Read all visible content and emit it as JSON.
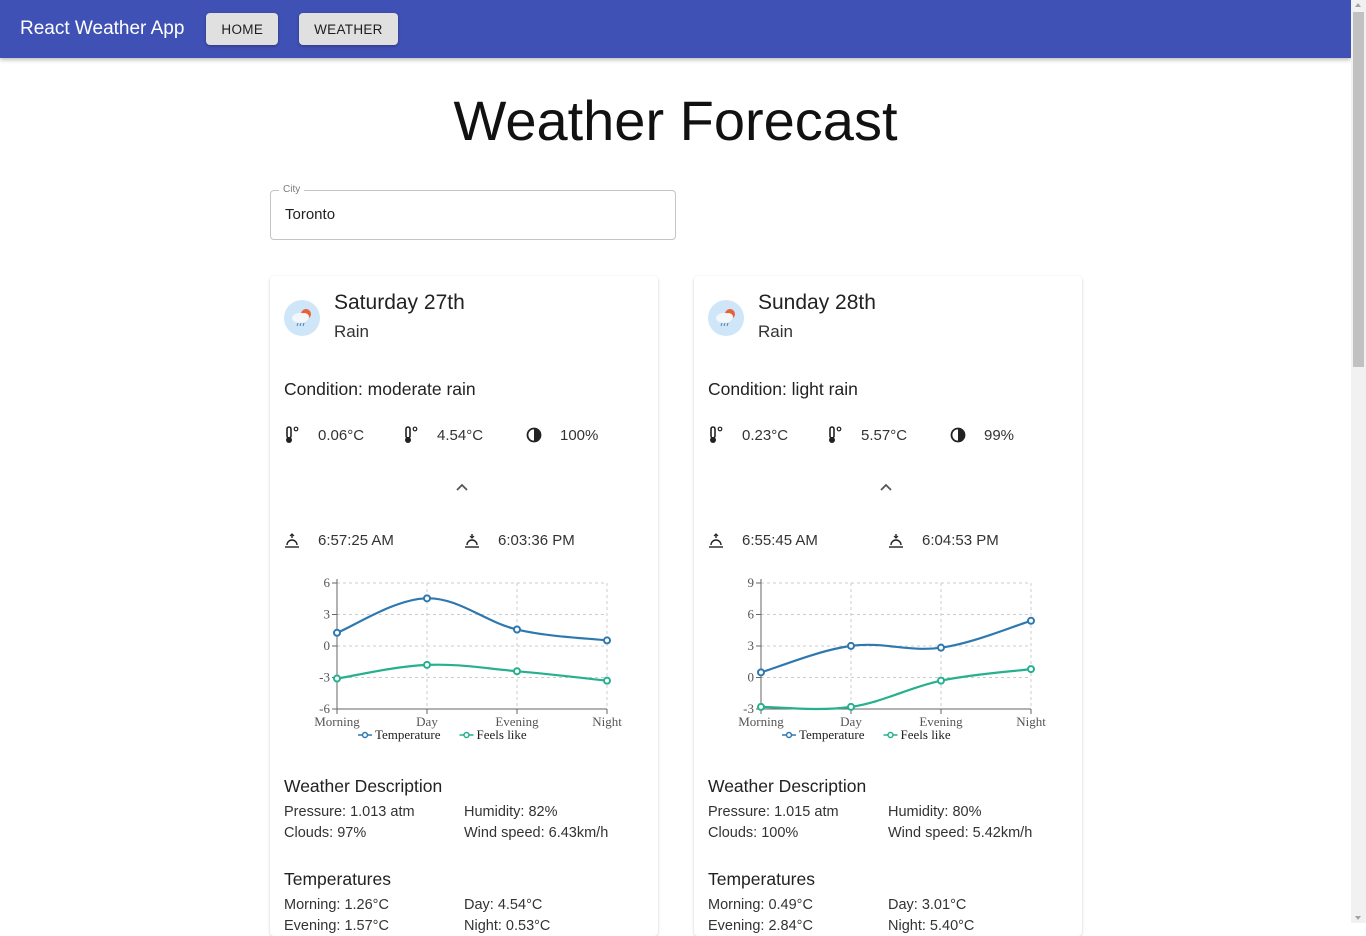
{
  "appbar": {
    "title": "React Weather App",
    "nav": [
      {
        "label": "HOME"
      },
      {
        "label": "WEATHER"
      }
    ],
    "color": "#3f51b5"
  },
  "page": {
    "title": "Weather Forecast"
  },
  "city": {
    "label": "City",
    "value": "Toronto"
  },
  "cards": [
    {
      "day": "Saturday 27th",
      "main": "Rain",
      "icon": "rain-cloud-icon",
      "condition": "Condition: moderate rain",
      "temp_min": "0.06°C",
      "temp_max": "4.54°C",
      "humidity_pct": "100%",
      "sunrise": "6:57:25 AM",
      "sunset": "6:03:36 PM",
      "desc_title": "Weather Description",
      "pressure": "Pressure: 1.013 atm",
      "humidity": "Humidity: 82%",
      "clouds": "Clouds: 97%",
      "wind": "Wind speed: 6.43km/h",
      "temps_title": "Temperatures",
      "morning": "Morning: 1.26°C",
      "day_temp": "Day: 4.54°C",
      "evening": "Evening: 1.57°C",
      "night": "Night: 0.53°C"
    },
    {
      "day": "Sunday 28th",
      "main": "Rain",
      "icon": "rain-cloud-icon",
      "condition": "Condition: light rain",
      "temp_min": "0.23°C",
      "temp_max": "5.57°C",
      "humidity_pct": "99%",
      "sunrise": "6:55:45 AM",
      "sunset": "6:04:53 PM",
      "desc_title": "Weather Description",
      "pressure": "Pressure: 1.015 atm",
      "humidity": "Humidity: 80%",
      "clouds": "Clouds: 100%",
      "wind": "Wind speed: 5.42km/h",
      "temps_title": "Temperatures",
      "morning": "Morning: 0.49°C",
      "day_temp": "Day: 3.01°C",
      "evening": "Evening: 2.84°C",
      "night": "Night: 5.40°C"
    }
  ],
  "chart_data": [
    {
      "type": "line",
      "title": "",
      "categories": [
        "Morning",
        "Day",
        "Evening",
        "Night"
      ],
      "yticks": [
        -6,
        -3,
        0,
        3,
        6
      ],
      "ylim": [
        -6,
        6
      ],
      "grid": true,
      "legend": "bottom",
      "series": [
        {
          "name": "Temperature",
          "color": "#2e78b0",
          "values": [
            1.26,
            4.54,
            1.57,
            0.53
          ]
        },
        {
          "name": "Feels like",
          "color": "#26b08f",
          "values": [
            -3.1,
            -1.8,
            -2.4,
            -3.3
          ]
        }
      ]
    },
    {
      "type": "line",
      "title": "",
      "categories": [
        "Morning",
        "Day",
        "Evening",
        "Night"
      ],
      "yticks": [
        -3,
        0,
        3,
        6,
        9
      ],
      "ylim": [
        -3,
        9
      ],
      "grid": true,
      "legend": "bottom",
      "series": [
        {
          "name": "Temperature",
          "color": "#2e78b0",
          "values": [
            0.49,
            3.01,
            2.84,
            5.4
          ]
        },
        {
          "name": "Feels like",
          "color": "#26b08f",
          "values": [
            -2.8,
            -2.8,
            -0.3,
            0.8
          ]
        }
      ]
    }
  ]
}
